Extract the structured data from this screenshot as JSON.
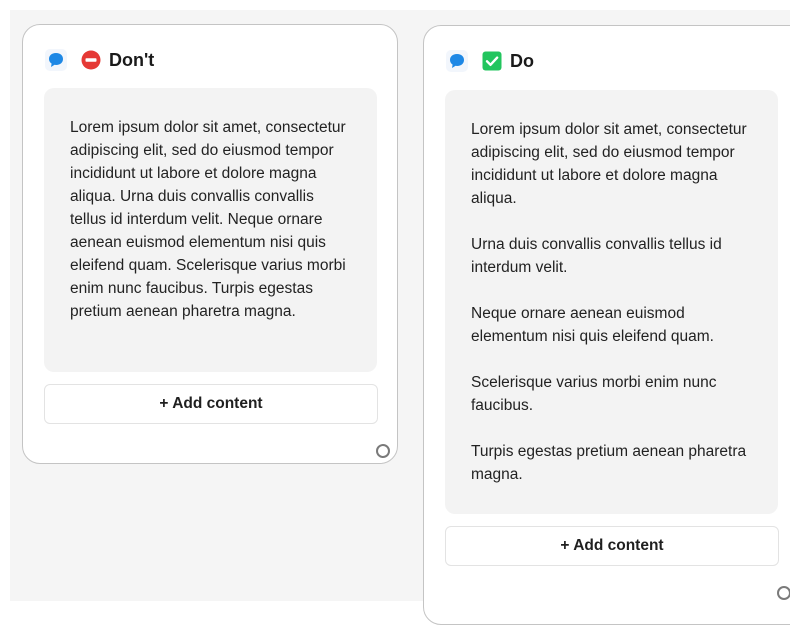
{
  "colors": {
    "accent_blue": "#1e88e5",
    "dont_red": "#e53935",
    "do_green": "#22c55e"
  },
  "cards": {
    "dont": {
      "title": "Don't",
      "status_icon": "no-entry-icon",
      "paragraphs": [
        "Lorem ipsum dolor sit amet, consectetur adipiscing elit, sed do eiusmod tempor incididunt ut labore et dolore magna aliqua. Urna duis convallis convallis tellus id interdum velit. Neque ornare aenean euismod elementum nisi quis eleifend quam. Scelerisque varius morbi enim nunc faucibus. Turpis egestas pretium aenean pharetra magna."
      ],
      "add_label": "+ Add content"
    },
    "do": {
      "title": "Do",
      "status_icon": "check-box-icon",
      "paragraphs": [
        "Lorem ipsum dolor sit amet, consectetur adipiscing elit, sed do eiusmod tempor incididunt ut labore et dolore magna aliqua.",
        "Urna duis convallis convallis tellus id interdum velit.",
        "Neque ornare aenean euismod elementum nisi quis eleifend quam.",
        "Scelerisque varius morbi enim nunc faucibus.",
        "Turpis egestas pretium aenean pharetra magna."
      ],
      "add_label": "+ Add content"
    }
  }
}
